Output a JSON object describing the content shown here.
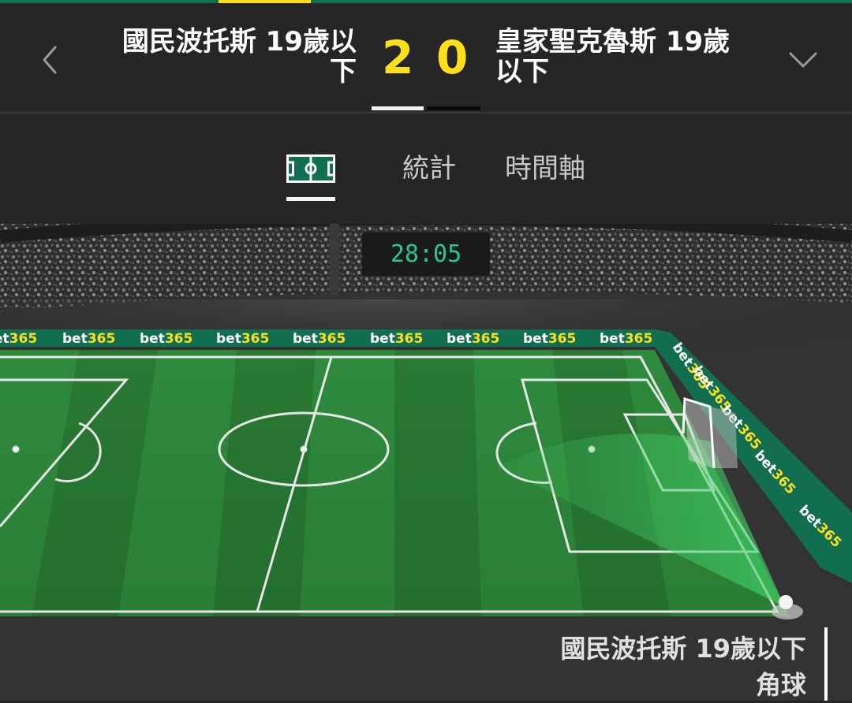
{
  "header": {
    "home_team": "國民波托斯 19歲以下",
    "away_team": "皇家聖克魯斯 19歲以下",
    "home_score": "2",
    "away_score": "0"
  },
  "tabs": [
    {
      "label": "pitch-icon",
      "active": true
    },
    {
      "label": "統計"
    },
    {
      "label": "時間軸"
    }
  ],
  "pitch": {
    "clock": "28:05",
    "board_brand": "bet365",
    "event_team": "國民波托斯 19歲以下",
    "event_type": "角球",
    "colors": {
      "brand_green": "#126e51",
      "accent_yellow": "#ffdf1b",
      "clock_green": "#26c98c"
    }
  }
}
